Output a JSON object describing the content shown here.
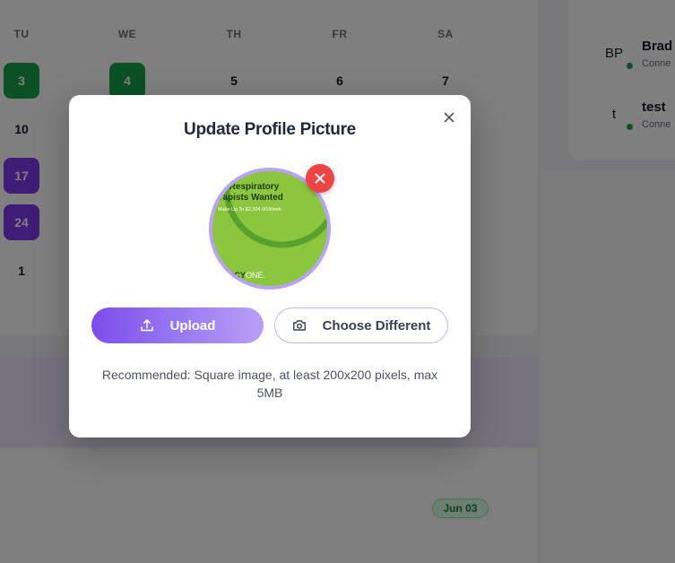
{
  "calendar": {
    "headers": [
      "TU",
      "WE",
      "TH",
      "FR",
      "SA"
    ],
    "days": {
      "tu_w1": "3",
      "we_w1": "4",
      "th_w1": "5",
      "fr_w1": "6",
      "sa_w1": "7",
      "tu_w2": "10",
      "tu_w3": "17",
      "tu_w4": "24",
      "tu_w5": "1"
    },
    "highlight_colors": {
      "green": "#16a34a",
      "purple": "#7c3aed"
    }
  },
  "contacts": [
    {
      "initials": "BP",
      "name": "Brad",
      "status": "Conne"
    },
    {
      "initials": "t",
      "name": "test",
      "status": "Conne"
    }
  ],
  "badge": {
    "date": "Jun 03"
  },
  "modal": {
    "title": "Update Profile Picture",
    "close_icon": "close-icon",
    "remove_icon": "x-icon",
    "preview": {
      "line1": "vel Respiratory",
      "line2": "erapists Wanted",
      "line3": "Make Up To $2,304.00/Week",
      "brand_bold": "RCY",
      "brand_light": "ONE."
    },
    "upload_label": "Upload",
    "upload_icon": "upload-icon",
    "choose_label": "Choose Different",
    "choose_icon": "camera-icon",
    "hint": "Recommended: Square image, at least 200x200 pixels, max 5MB"
  },
  "colors": {
    "accent": "#7c4dec",
    "danger": "#ef4444",
    "preview_green": "#8cc63f"
  }
}
